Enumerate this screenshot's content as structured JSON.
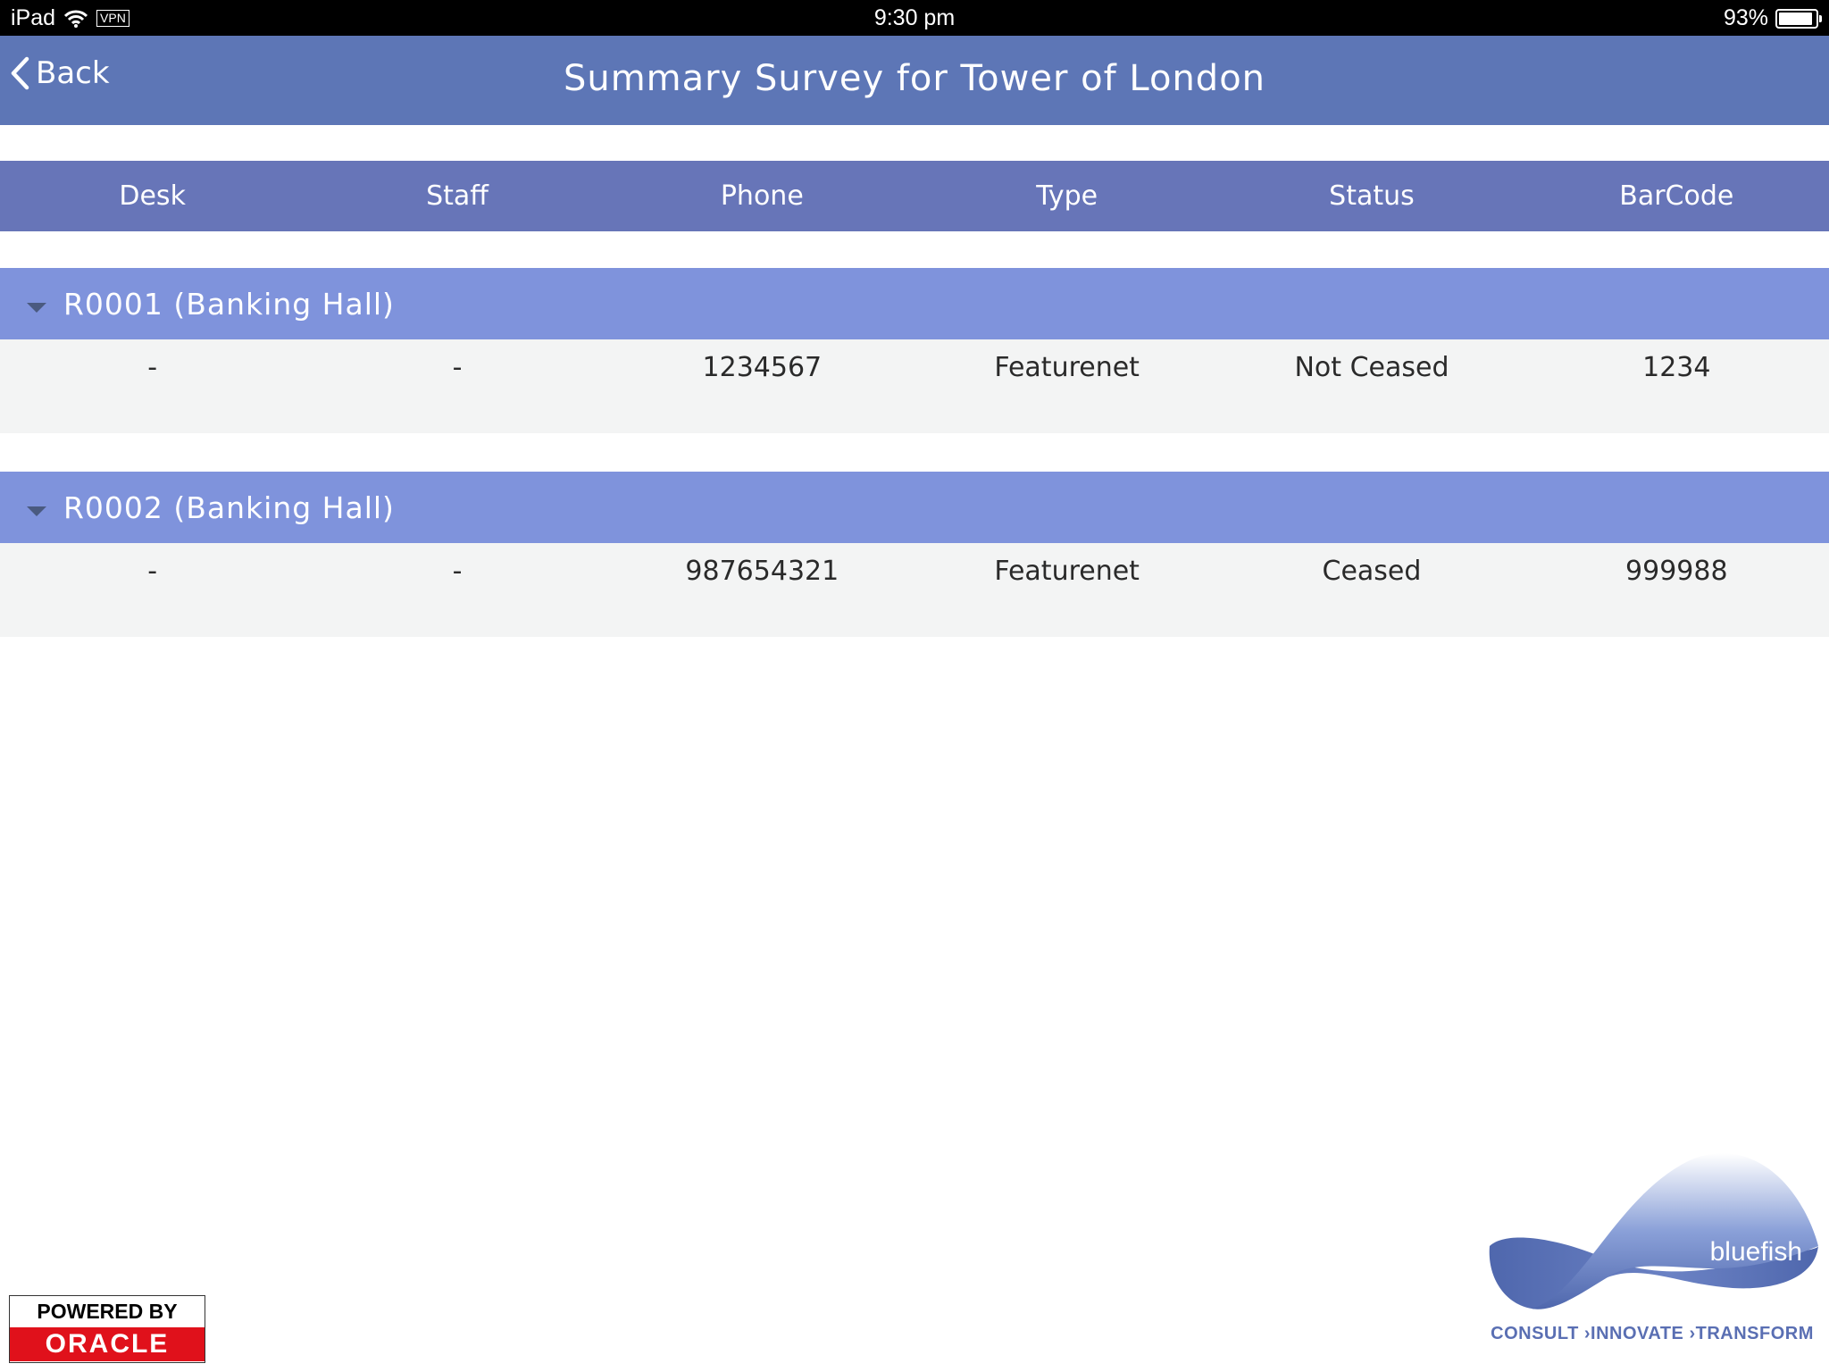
{
  "status_bar": {
    "device": "iPad",
    "vpn": "VPN",
    "time": "9:30 pm",
    "battery": "93%",
    "battery_level": 0.93
  },
  "nav": {
    "back_label": "Back",
    "title": "Summary Survey for Tower of London"
  },
  "table": {
    "columns": [
      "Desk",
      "Staff",
      "Phone",
      "Type",
      "Status",
      "BarCode"
    ],
    "groups": [
      {
        "label": "R0001 (Banking Hall)",
        "rows": [
          [
            "-",
            "-",
            "1234567",
            "Featurenet",
            "Not Ceased",
            "1234"
          ]
        ]
      },
      {
        "label": "R0002 (Banking Hall)",
        "rows": [
          [
            "-",
            "-",
            "987654321",
            "Featurenet",
            "Ceased",
            "999988"
          ]
        ]
      }
    ]
  },
  "footer": {
    "oracle_top": "POWERED BY",
    "oracle_brand": "ORACLE",
    "bluefish_brand": "bluefish",
    "bluefish_tagline": "CONSULT ›INNOVATE ›TRANSFORM"
  },
  "colors": {
    "nav_bar": "#5d76b6",
    "column_header": "#6775b8",
    "group_header": "#7f93dc",
    "row_background": "#f3f4f4",
    "oracle_red": "#e0111b"
  }
}
